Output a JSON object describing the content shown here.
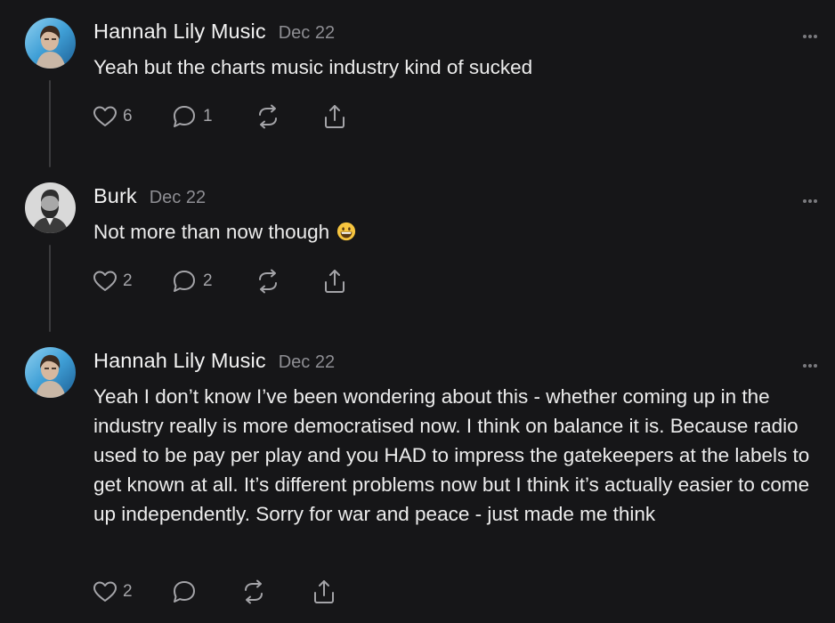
{
  "posts": [
    {
      "author": "Hannah Lily Music",
      "date": "Dec 22",
      "text": "Yeah but the charts music industry kind of sucked",
      "likes": "6",
      "comments": "1",
      "avatar": "profile-photo-woman"
    },
    {
      "author": "Burk",
      "date": "Dec 22",
      "text": "Not more than now though",
      "emoji": "grinning-face-emoji",
      "likes": "2",
      "comments": "2",
      "avatar": "profile-photo-bearded-man"
    },
    {
      "author": "Hannah Lily Music",
      "date": "Dec 22",
      "text": "Yeah I don’t know I’ve been wondering about this - whether coming up in the industry really is more democratised now. I think on balance it is. Because radio used to be pay per play and you HAD to impress the gatekeepers at the labels to get known at all. It’s different problems now but I think it’s actually easier to come up independently. Sorry for war and peace - just made me think",
      "likes": "2",
      "comments": "",
      "avatar": "profile-photo-woman"
    }
  ],
  "icons": {
    "like": "heart-icon",
    "comment": "comment-bubble-icon",
    "restack": "restack-icon",
    "share": "share-icon",
    "more": "more-dots-icon"
  },
  "colors": {
    "background": "#161618",
    "text": "#ececec",
    "muted": "#8e8e93",
    "icon": "#a4a4a8",
    "thread_line": "#3a3a3d"
  }
}
